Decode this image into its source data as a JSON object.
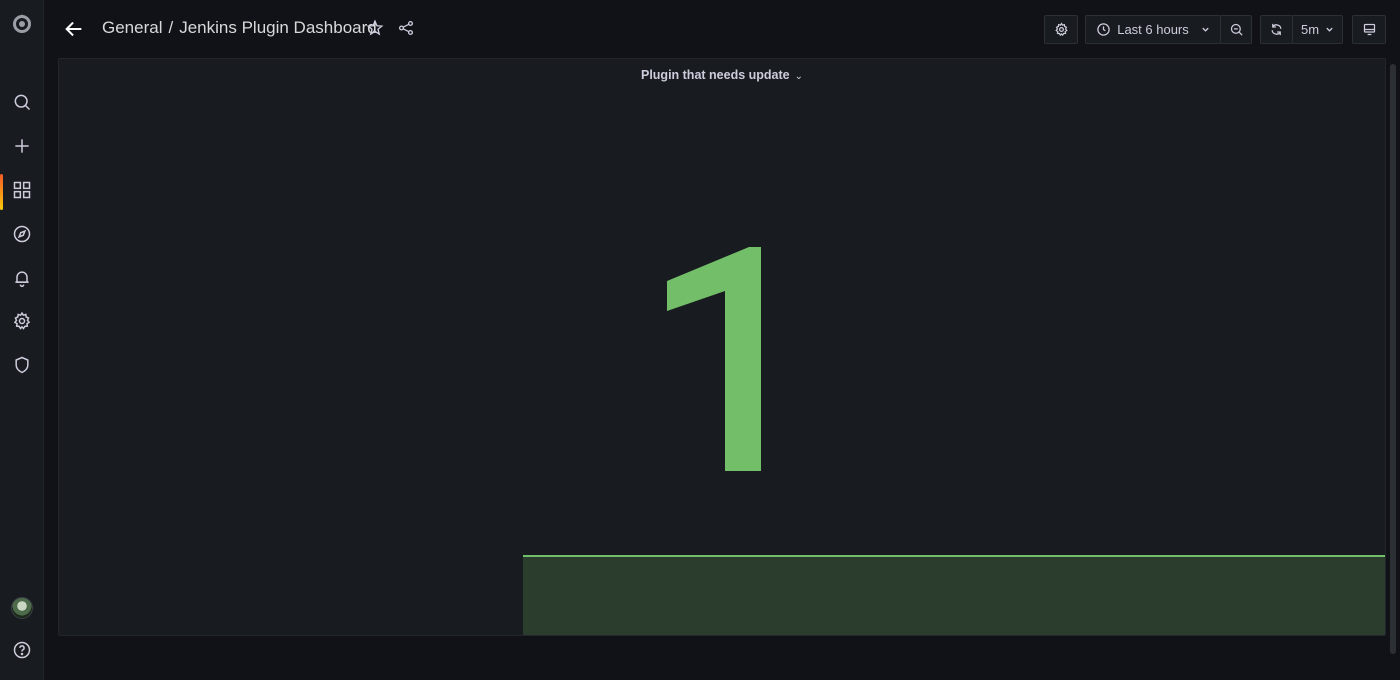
{
  "sidebar": {
    "items": [
      {
        "icon": "grafana-logo-icon"
      },
      {
        "icon": "search-icon"
      },
      {
        "icon": "plus-icon"
      },
      {
        "icon": "dashboards-icon",
        "active": true
      },
      {
        "icon": "compass-icon"
      },
      {
        "icon": "bell-icon"
      },
      {
        "icon": "gear-icon"
      },
      {
        "icon": "shield-icon"
      },
      {
        "icon": "avatar"
      },
      {
        "icon": "help-icon"
      }
    ]
  },
  "header": {
    "breadcrumb_folder": "General",
    "breadcrumb_separator": "/",
    "breadcrumb_title": "Jenkins Plugin Dashboard"
  },
  "toolbar": {
    "time_range": "Last 6 hours",
    "refresh_interval": "5m"
  },
  "panel": {
    "title": "Plugin that needs update",
    "value": "1",
    "value_color": "#73bf69",
    "sparkline_fill": "#2b3e2d"
  }
}
